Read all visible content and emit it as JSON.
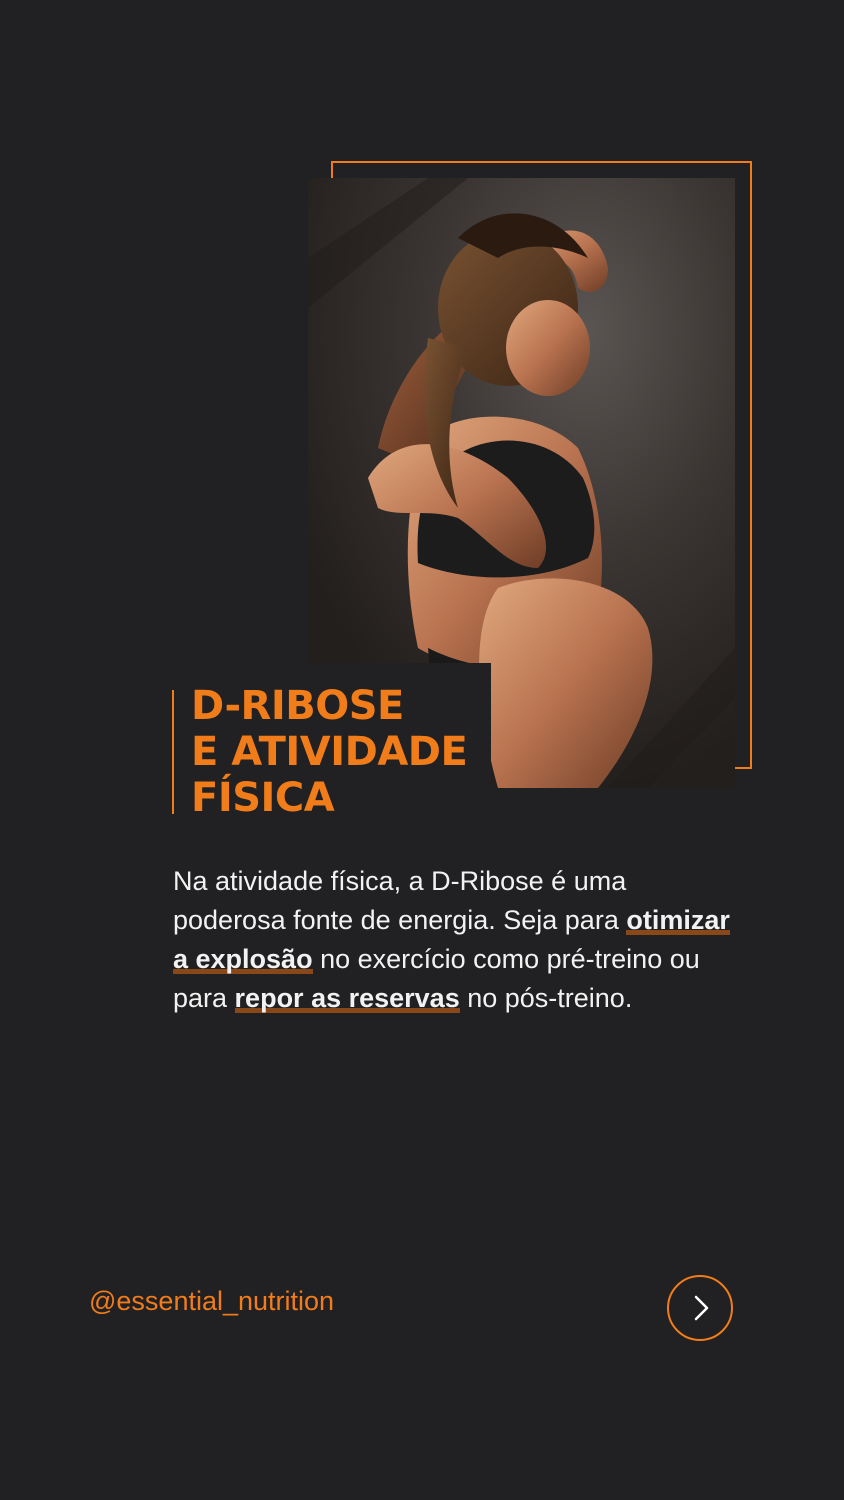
{
  "slide": {
    "title_lines": [
      "D-RIBOSE",
      "E ATIVIDADE",
      "FÍSICA"
    ],
    "body": {
      "part1": "Na atividade física, a D-Ribose é uma poderosa fonte de energia. Seja para ",
      "highlight1": "otimizar a explosão",
      "part2": " no exercício como pré-treino ou para ",
      "highlight2": "repor as reservas",
      "part3": " no pós-treino."
    },
    "handle": "@essential_nutrition",
    "next_icon": "chevron-right-icon"
  },
  "colors": {
    "background": "#212022",
    "accent": "#f07c1a",
    "text": "#f2f2f2",
    "highlight_underline": "#8a4717"
  }
}
